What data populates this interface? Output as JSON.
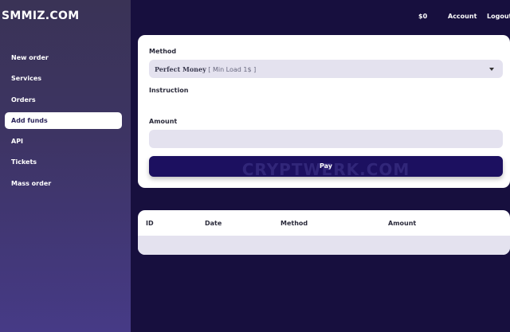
{
  "brand": "SMMIZ.COM",
  "nav": [
    {
      "label": "New order",
      "active": false
    },
    {
      "label": "Services",
      "active": false
    },
    {
      "label": "Orders",
      "active": false
    },
    {
      "label": "Add funds",
      "active": true
    },
    {
      "label": "API",
      "active": false
    },
    {
      "label": "Tickets",
      "active": false
    },
    {
      "label": "Mass order",
      "active": false
    }
  ],
  "topbar": {
    "balance": "$0",
    "account": "Account",
    "logout": "Logout"
  },
  "form": {
    "method_label": "Method",
    "method_name": "Perfect Money",
    "method_suffix": "[ Min Load 1$ ]",
    "instruction_label": "Instruction",
    "amount_label": "Amount",
    "amount_value": "",
    "pay_label": "Pay",
    "watermark": "CRYPTWERK.COM"
  },
  "table": {
    "columns": [
      "ID",
      "Date",
      "Method",
      "Amount"
    ]
  },
  "colors": {
    "background": "#170f3e",
    "accent": "#1c1060",
    "field": "#e4e2ef"
  }
}
